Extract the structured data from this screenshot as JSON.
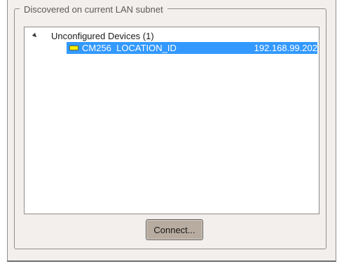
{
  "groupbox": {
    "title": "Discovered on current LAN subnet"
  },
  "tree": {
    "group": {
      "label": "Unconfigured Devices (1)",
      "expanded": true,
      "expander_icon": "triangle-expanded-icon"
    },
    "devices": [
      {
        "name": "CM256  LOCATION_ID",
        "ip": "192.168.99.202",
        "selected": true,
        "icon": "device-status-icon",
        "icon_color": "#fff000"
      }
    ],
    "selection_color": "#3399ff"
  },
  "actions": {
    "connect_label": "Connect..."
  }
}
